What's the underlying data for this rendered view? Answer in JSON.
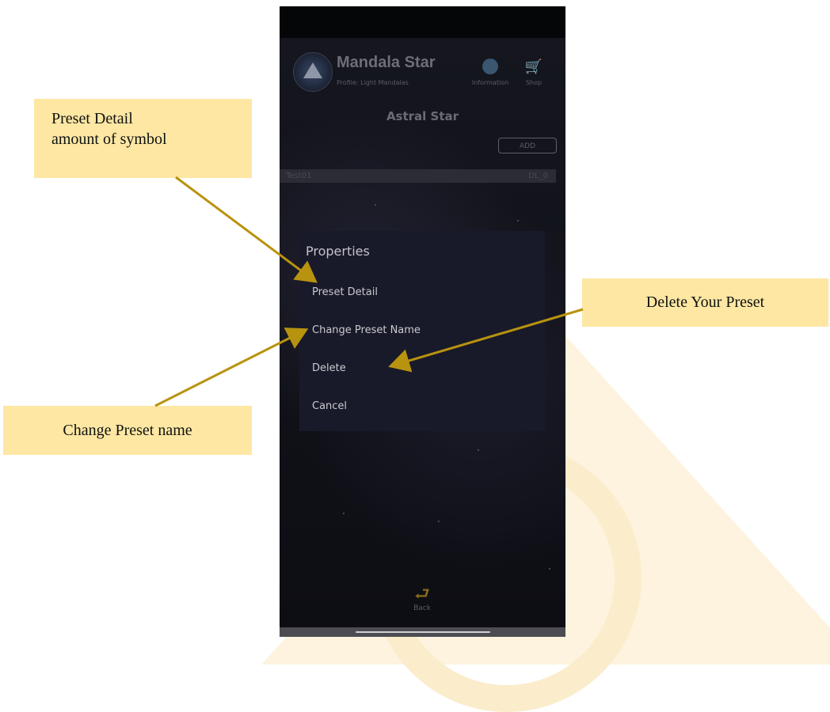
{
  "app": {
    "title": "Mandala Star",
    "profile": "Profile: Light Mandalas",
    "information_label": "Information",
    "shop_label": "Shop"
  },
  "page": {
    "title": "Astral Star",
    "add_label": "ADD"
  },
  "presets": [
    {
      "name": "Test01",
      "dl": "DL_0"
    }
  ],
  "dialog": {
    "title": "Properties",
    "items": [
      "Preset Detail",
      "Change Preset Name",
      "Delete",
      "Cancel"
    ]
  },
  "back_label": "Back",
  "callouts": {
    "preset_detail_line1": "Preset Detail",
    "preset_detail_line2": "amount of symbol",
    "delete": "Delete Your Preset",
    "change_name": "Change Preset name"
  },
  "colors": {
    "callout_bg": "#fde7a3",
    "arrow": "#b8930f",
    "dialog_bg": "#191a29"
  },
  "icons": {
    "info": "globe-icon",
    "shop": "cart-icon",
    "back": "back-arrow-icon",
    "logo": "mandala-logo-icon"
  }
}
